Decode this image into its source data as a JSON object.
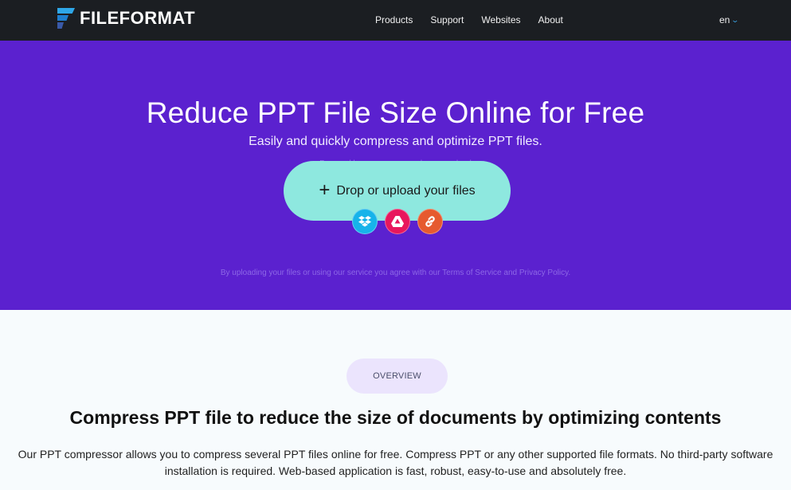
{
  "header": {
    "brand": "FILEFORMAT",
    "nav": [
      "Products",
      "Support",
      "Websites",
      "About"
    ],
    "language": "en"
  },
  "hero": {
    "title": "Reduce PPT File Size Online for Free",
    "subtitle": "Easily and quickly compress and optimize PPT files.",
    "powered_by": "Powered by aspose.com and aspose.cloud",
    "upload_label": "Drop or upload your files",
    "sources": [
      {
        "name": "Dropbox",
        "icon": "dropbox-icon",
        "color": "#17b3ea"
      },
      {
        "name": "Google Drive",
        "icon": "google-drive-icon",
        "color": "#e8175d"
      },
      {
        "name": "URL",
        "icon": "link-icon",
        "color": "#e65a2f"
      }
    ],
    "terms": "By uploading your files or using our service you agree with our Terms of Service and Privacy Policy."
  },
  "overview": {
    "badge": "OVERVIEW",
    "heading": "Compress PPT file to reduce the size of documents by optimizing contents",
    "paragraph": "Our PPT compressor allows you to compress several PPT files online for free. Compress PPT or any other supported file formats. No third-party software installation is required. Web-based application is fast, robust, easy-to-use and absolutely free."
  },
  "colors": {
    "header_bg": "#1b1e22",
    "hero_bg": "#5b21cf",
    "upload_bg": "#8ee8df",
    "page_bg": "#f7fbfd",
    "badge_bg": "#ebe4fd"
  }
}
